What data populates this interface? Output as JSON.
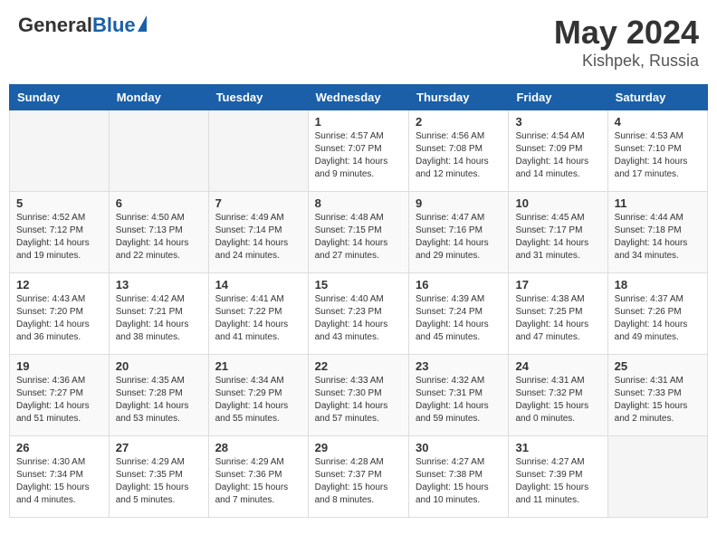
{
  "header": {
    "logo_general": "General",
    "logo_blue": "Blue",
    "title": "May 2024",
    "location": "Kishpek, Russia"
  },
  "days_of_week": [
    "Sunday",
    "Monday",
    "Tuesday",
    "Wednesday",
    "Thursday",
    "Friday",
    "Saturday"
  ],
  "weeks": [
    [
      {
        "day": "",
        "info": ""
      },
      {
        "day": "",
        "info": ""
      },
      {
        "day": "",
        "info": ""
      },
      {
        "day": "1",
        "sunrise": "Sunrise: 4:57 AM",
        "sunset": "Sunset: 7:07 PM",
        "daylight": "Daylight: 14 hours and 9 minutes."
      },
      {
        "day": "2",
        "sunrise": "Sunrise: 4:56 AM",
        "sunset": "Sunset: 7:08 PM",
        "daylight": "Daylight: 14 hours and 12 minutes."
      },
      {
        "day": "3",
        "sunrise": "Sunrise: 4:54 AM",
        "sunset": "Sunset: 7:09 PM",
        "daylight": "Daylight: 14 hours and 14 minutes."
      },
      {
        "day": "4",
        "sunrise": "Sunrise: 4:53 AM",
        "sunset": "Sunset: 7:10 PM",
        "daylight": "Daylight: 14 hours and 17 minutes."
      }
    ],
    [
      {
        "day": "5",
        "sunrise": "Sunrise: 4:52 AM",
        "sunset": "Sunset: 7:12 PM",
        "daylight": "Daylight: 14 hours and 19 minutes."
      },
      {
        "day": "6",
        "sunrise": "Sunrise: 4:50 AM",
        "sunset": "Sunset: 7:13 PM",
        "daylight": "Daylight: 14 hours and 22 minutes."
      },
      {
        "day": "7",
        "sunrise": "Sunrise: 4:49 AM",
        "sunset": "Sunset: 7:14 PM",
        "daylight": "Daylight: 14 hours and 24 minutes."
      },
      {
        "day": "8",
        "sunrise": "Sunrise: 4:48 AM",
        "sunset": "Sunset: 7:15 PM",
        "daylight": "Daylight: 14 hours and 27 minutes."
      },
      {
        "day": "9",
        "sunrise": "Sunrise: 4:47 AM",
        "sunset": "Sunset: 7:16 PM",
        "daylight": "Daylight: 14 hours and 29 minutes."
      },
      {
        "day": "10",
        "sunrise": "Sunrise: 4:45 AM",
        "sunset": "Sunset: 7:17 PM",
        "daylight": "Daylight: 14 hours and 31 minutes."
      },
      {
        "day": "11",
        "sunrise": "Sunrise: 4:44 AM",
        "sunset": "Sunset: 7:18 PM",
        "daylight": "Daylight: 14 hours and 34 minutes."
      }
    ],
    [
      {
        "day": "12",
        "sunrise": "Sunrise: 4:43 AM",
        "sunset": "Sunset: 7:20 PM",
        "daylight": "Daylight: 14 hours and 36 minutes."
      },
      {
        "day": "13",
        "sunrise": "Sunrise: 4:42 AM",
        "sunset": "Sunset: 7:21 PM",
        "daylight": "Daylight: 14 hours and 38 minutes."
      },
      {
        "day": "14",
        "sunrise": "Sunrise: 4:41 AM",
        "sunset": "Sunset: 7:22 PM",
        "daylight": "Daylight: 14 hours and 41 minutes."
      },
      {
        "day": "15",
        "sunrise": "Sunrise: 4:40 AM",
        "sunset": "Sunset: 7:23 PM",
        "daylight": "Daylight: 14 hours and 43 minutes."
      },
      {
        "day": "16",
        "sunrise": "Sunrise: 4:39 AM",
        "sunset": "Sunset: 7:24 PM",
        "daylight": "Daylight: 14 hours and 45 minutes."
      },
      {
        "day": "17",
        "sunrise": "Sunrise: 4:38 AM",
        "sunset": "Sunset: 7:25 PM",
        "daylight": "Daylight: 14 hours and 47 minutes."
      },
      {
        "day": "18",
        "sunrise": "Sunrise: 4:37 AM",
        "sunset": "Sunset: 7:26 PM",
        "daylight": "Daylight: 14 hours and 49 minutes."
      }
    ],
    [
      {
        "day": "19",
        "sunrise": "Sunrise: 4:36 AM",
        "sunset": "Sunset: 7:27 PM",
        "daylight": "Daylight: 14 hours and 51 minutes."
      },
      {
        "day": "20",
        "sunrise": "Sunrise: 4:35 AM",
        "sunset": "Sunset: 7:28 PM",
        "daylight": "Daylight: 14 hours and 53 minutes."
      },
      {
        "day": "21",
        "sunrise": "Sunrise: 4:34 AM",
        "sunset": "Sunset: 7:29 PM",
        "daylight": "Daylight: 14 hours and 55 minutes."
      },
      {
        "day": "22",
        "sunrise": "Sunrise: 4:33 AM",
        "sunset": "Sunset: 7:30 PM",
        "daylight": "Daylight: 14 hours and 57 minutes."
      },
      {
        "day": "23",
        "sunrise": "Sunrise: 4:32 AM",
        "sunset": "Sunset: 7:31 PM",
        "daylight": "Daylight: 14 hours and 59 minutes."
      },
      {
        "day": "24",
        "sunrise": "Sunrise: 4:31 AM",
        "sunset": "Sunset: 7:32 PM",
        "daylight": "Daylight: 15 hours and 0 minutes."
      },
      {
        "day": "25",
        "sunrise": "Sunrise: 4:31 AM",
        "sunset": "Sunset: 7:33 PM",
        "daylight": "Daylight: 15 hours and 2 minutes."
      }
    ],
    [
      {
        "day": "26",
        "sunrise": "Sunrise: 4:30 AM",
        "sunset": "Sunset: 7:34 PM",
        "daylight": "Daylight: 15 hours and 4 minutes."
      },
      {
        "day": "27",
        "sunrise": "Sunrise: 4:29 AM",
        "sunset": "Sunset: 7:35 PM",
        "daylight": "Daylight: 15 hours and 5 minutes."
      },
      {
        "day": "28",
        "sunrise": "Sunrise: 4:29 AM",
        "sunset": "Sunset: 7:36 PM",
        "daylight": "Daylight: 15 hours and 7 minutes."
      },
      {
        "day": "29",
        "sunrise": "Sunrise: 4:28 AM",
        "sunset": "Sunset: 7:37 PM",
        "daylight": "Daylight: 15 hours and 8 minutes."
      },
      {
        "day": "30",
        "sunrise": "Sunrise: 4:27 AM",
        "sunset": "Sunset: 7:38 PM",
        "daylight": "Daylight: 15 hours and 10 minutes."
      },
      {
        "day": "31",
        "sunrise": "Sunrise: 4:27 AM",
        "sunset": "Sunset: 7:39 PM",
        "daylight": "Daylight: 15 hours and 11 minutes."
      },
      {
        "day": "",
        "info": ""
      }
    ]
  ]
}
